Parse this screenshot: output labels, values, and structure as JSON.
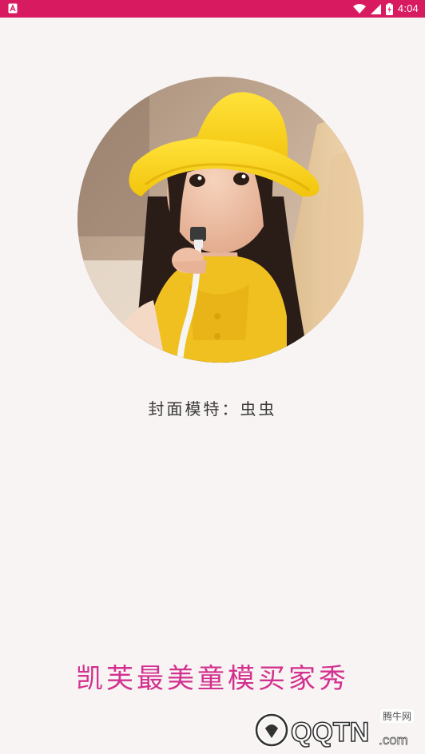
{
  "status_bar": {
    "time": "4:04",
    "icons": [
      "notification-icon",
      "wifi-icon",
      "signal-icon",
      "battery-icon"
    ],
    "background_color": "#d81b60"
  },
  "cover": {
    "caption": "封面模特：虫虫"
  },
  "slogan": "凯芙最美童模买家秀",
  "watermark": {
    "site_label": "腾牛网",
    "logo_text": "QQTN",
    "logo_suffix": ".com"
  },
  "colors": {
    "accent": "#d81b60",
    "slogan": "#d3318f",
    "background": "#f8f4f3"
  }
}
